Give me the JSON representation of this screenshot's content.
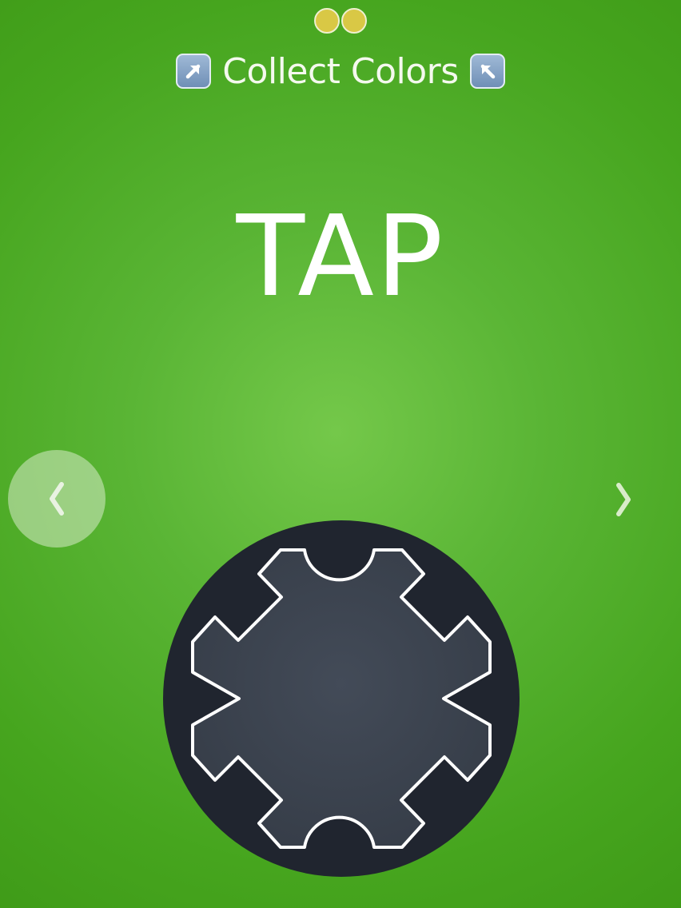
{
  "header": {
    "progress_dots": [
      {
        "state": "collected",
        "color": "#d9c845"
      },
      {
        "state": "collected",
        "color": "#d9c845"
      }
    ],
    "mode_title": "Collect Colors",
    "left_badge_icon": "arrow-up-right-icon",
    "right_badge_icon": "arrow-up-left-icon"
  },
  "main": {
    "prompt": "TAP"
  },
  "navigation": {
    "prev_icon": "chevron-left-icon",
    "next_icon": "chevron-right-icon"
  },
  "dial": {
    "icon": "gear-icon",
    "colors": {
      "disc": "#20252f",
      "gear_fill": "#3c4450",
      "outline": "#ffffff"
    }
  },
  "colors": {
    "background": "#5ab535",
    "dot": "#d9c845"
  }
}
